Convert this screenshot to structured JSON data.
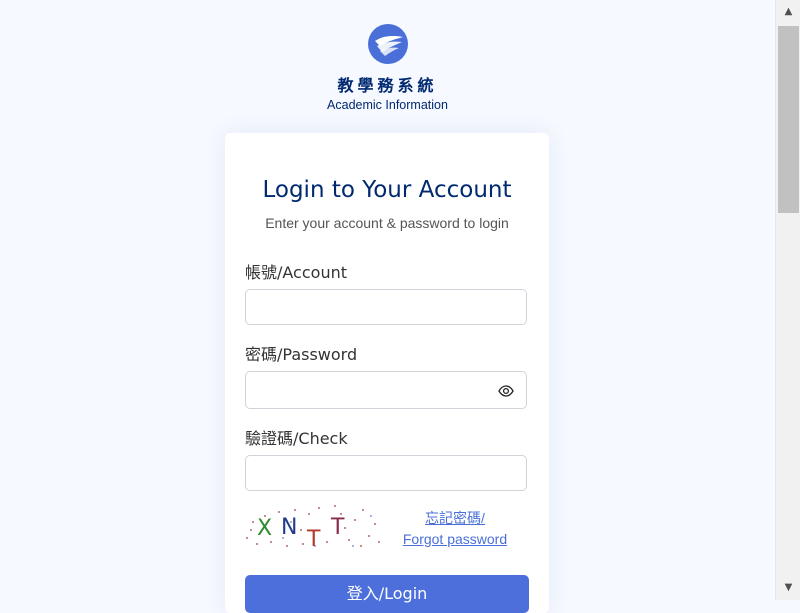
{
  "header": {
    "logo": "wing-logo",
    "title_zh": "教學務系統",
    "subtitle_en": "Academic Information"
  },
  "login_card": {
    "title": "Login to Your Account",
    "subtitle": "Enter your account & password to login",
    "account": {
      "label": "帳號/Account",
      "value": "",
      "placeholder": ""
    },
    "password": {
      "label": "密碼/Password",
      "value": "",
      "placeholder": "",
      "toggle_icon": "eye-icon"
    },
    "check": {
      "label": "驗證碼/Check",
      "value": "",
      "placeholder": ""
    },
    "captcha_text": "XNTT",
    "forgot_line1": "忘記密碼/",
    "forgot_line2": "Forgot password",
    "login_button": "登入/Login"
  },
  "colors": {
    "page_bg": "#f6f9ff",
    "brand_dark": "#012970",
    "accent": "#4d6fdc",
    "link": "#4a6fd8"
  }
}
